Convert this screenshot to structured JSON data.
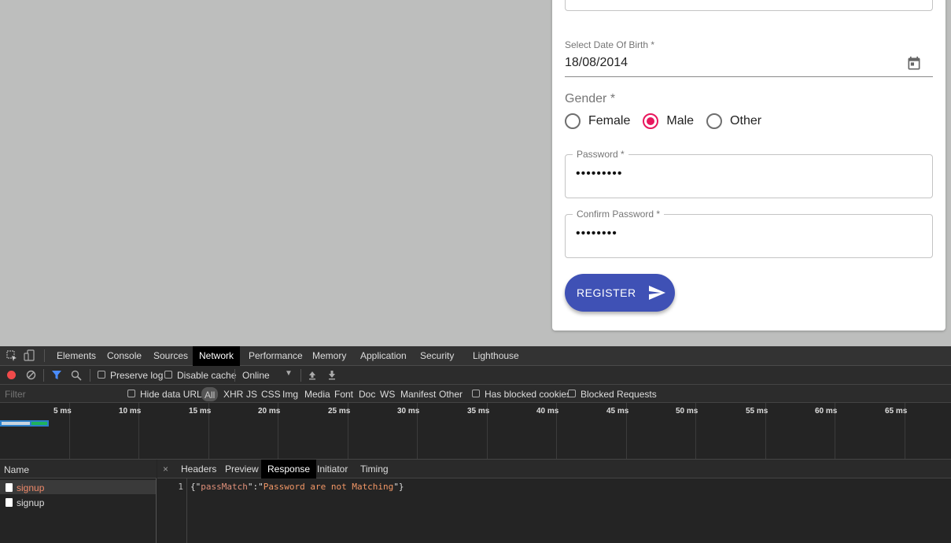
{
  "form": {
    "dob_label": "Select Date Of Birth *",
    "dob_value": "18/08/2014",
    "gender_label": "Gender *",
    "gender_options": [
      {
        "label": "Female",
        "checked": false
      },
      {
        "label": "Male",
        "checked": true
      },
      {
        "label": "Other",
        "checked": false
      }
    ],
    "password_label": "Password *",
    "password_value": "•••••••••",
    "confirm_password_label": "Confirm Password *",
    "confirm_password_value": "••••••••",
    "register_label": "REGISTER",
    "accent_color": "#e8175d",
    "button_color": "#3f51b5"
  },
  "devtools": {
    "tabs": [
      "Elements",
      "Console",
      "Sources",
      "Network",
      "Performance",
      "Memory",
      "Application",
      "Security",
      "Lighthouse"
    ],
    "active_tab": "Network",
    "toolbar": {
      "preserve_log": "Preserve log",
      "disable_cache": "Disable cache",
      "throttle": "Online"
    },
    "filter": {
      "placeholder": "Filter",
      "hide_data_urls": "Hide data URLs",
      "types": [
        "All",
        "XHR",
        "JS",
        "CSS",
        "Img",
        "Media",
        "Font",
        "Doc",
        "WS",
        "Manifest",
        "Other"
      ],
      "has_blocked_cookies": "Has blocked cookies",
      "blocked_requests": "Blocked Requests"
    },
    "timeline_labels": [
      "5 ms",
      "10 ms",
      "15 ms",
      "20 ms",
      "25 ms",
      "30 ms",
      "35 ms",
      "40 ms",
      "45 ms",
      "50 ms",
      "55 ms",
      "60 ms",
      "65 ms"
    ],
    "name_header": "Name",
    "requests": [
      {
        "name": "signup",
        "selected": true
      },
      {
        "name": "signup",
        "selected": false
      }
    ],
    "detail_tabs": [
      "Headers",
      "Preview",
      "Response",
      "Initiator",
      "Timing"
    ],
    "active_detail_tab": "Response",
    "response": {
      "line_number": "1",
      "key": "passMatch",
      "value": "Password are not Matching"
    }
  }
}
